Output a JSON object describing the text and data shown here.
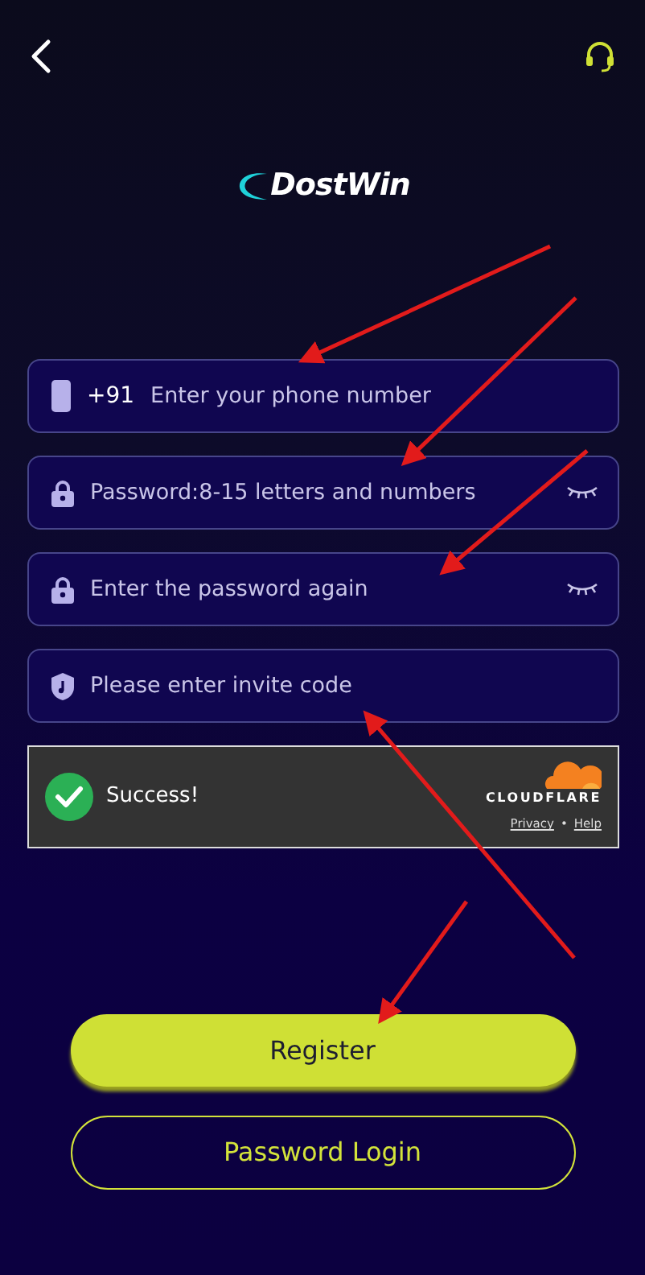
{
  "logo": {
    "text": "DostWin"
  },
  "fields": [
    {
      "kind": "phone",
      "prefix": "+91",
      "placeholder": "Enter your phone number"
    },
    {
      "kind": "password",
      "placeholder": "Password:8-15 letters and numbers"
    },
    {
      "kind": "password",
      "placeholder": "Enter the password again"
    },
    {
      "kind": "invite",
      "placeholder": "Please enter invite code"
    }
  ],
  "captcha": {
    "status": "Success!",
    "brand": "CLOUDFLARE",
    "links": [
      "Privacy",
      "Help"
    ],
    "separator": "•"
  },
  "buttons": [
    {
      "kind": "primary",
      "label": "Register"
    },
    {
      "kind": "outline",
      "label": "Password Login"
    }
  ]
}
